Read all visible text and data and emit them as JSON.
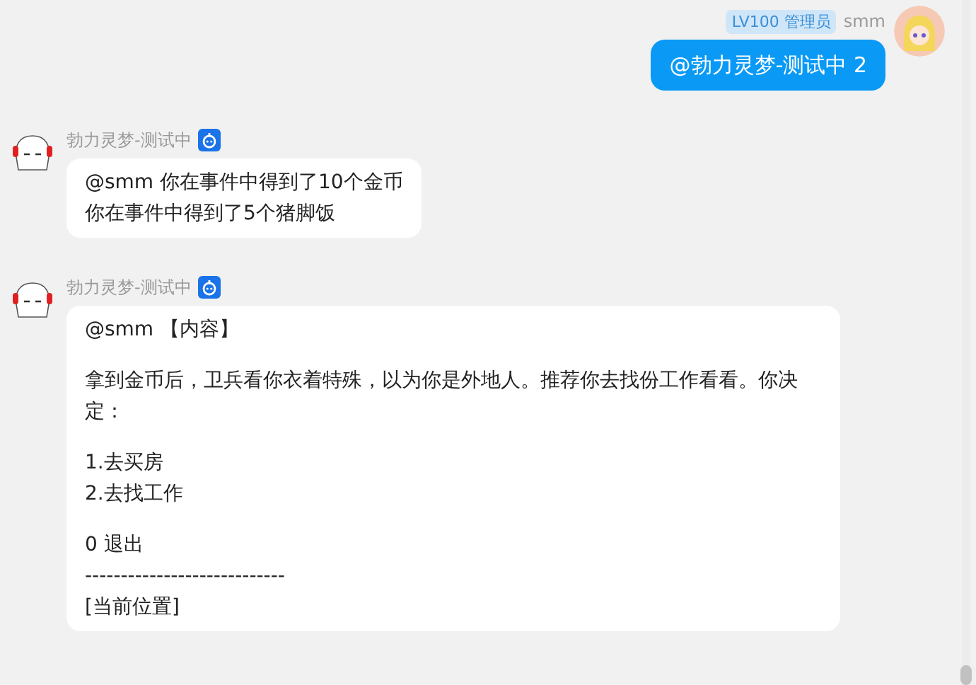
{
  "messages": [
    {
      "kind": "self",
      "name": "smm",
      "badge": "LV100 管理员",
      "bot": false,
      "paragraphs": [
        [
          "@勃力灵梦-测试中 2"
        ]
      ]
    },
    {
      "kind": "other",
      "name": "勃力灵梦-测试中",
      "bot": true,
      "paragraphs": [
        [
          "@smm 你在事件中得到了10个金币",
          "你在事件中得到了5个猪脚饭"
        ]
      ]
    },
    {
      "kind": "other",
      "name": "勃力灵梦-测试中",
      "bot": true,
      "paragraphs": [
        [
          "@smm 【内容】"
        ],
        [
          "拿到金币后，卫兵看你衣着特殊，以为你是外地人。推荐你去找份工作看看。你决定："
        ],
        [
          "1.去买房",
          "2.去找工作"
        ],
        [
          "0 退出",
          "----------------------------",
          "[当前位置]"
        ]
      ]
    }
  ]
}
